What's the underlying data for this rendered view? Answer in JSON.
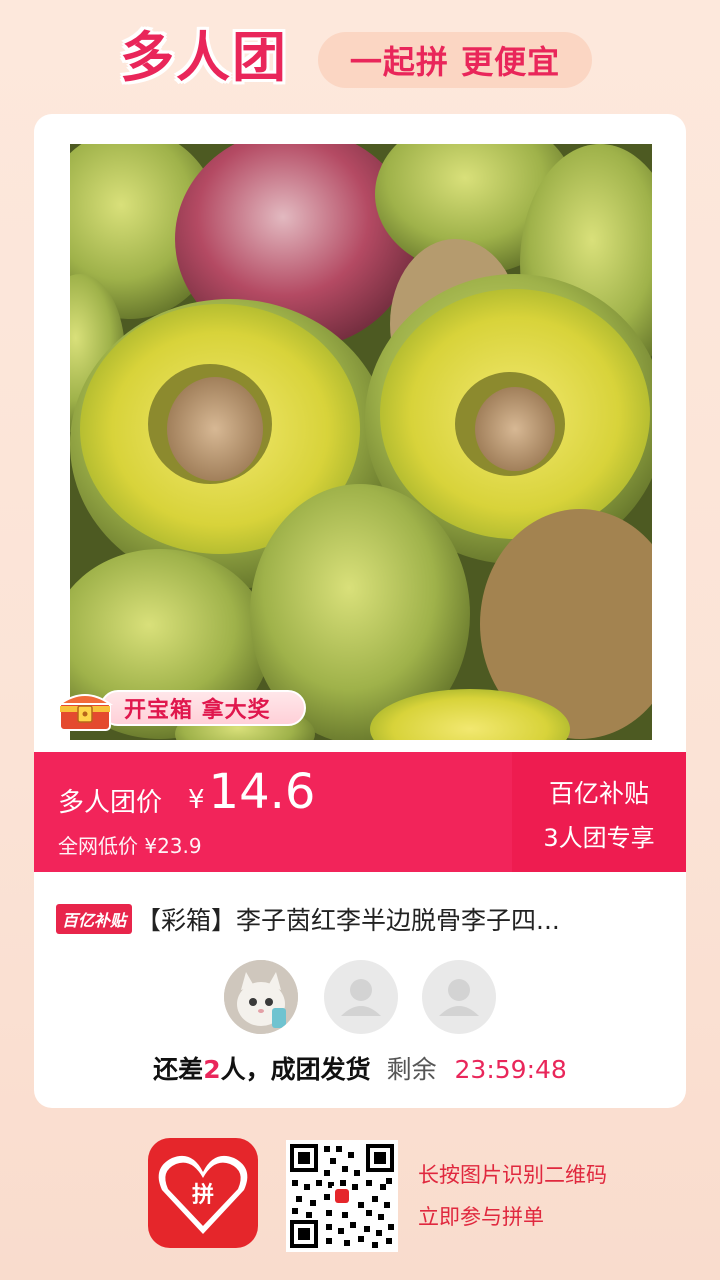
{
  "header": {
    "title": "多人团",
    "slogan": "一起拼 更便宜"
  },
  "badge": {
    "treasure_label": "开宝箱 拿大奖"
  },
  "price": {
    "label": "多人团价",
    "currency": "¥",
    "value": "14.6",
    "original_label": "全网低价",
    "original_value": "¥23.9",
    "subsidy_line1": "百亿补贴",
    "subsidy_line2": "3人团专享"
  },
  "product": {
    "tag": "百亿补贴",
    "title": "【彩箱】李子茵红李半边脱骨李子四..."
  },
  "group": {
    "prefix": "还差",
    "missing": "2",
    "suffix": "人，成团发货",
    "remaining_label": "剩余",
    "timer": "23:59:48"
  },
  "footer": {
    "line1": "长按图片识别二维码",
    "line2": "立即参与拼单"
  },
  "colors": {
    "accent": "#f2245a",
    "brand": "#e9265a"
  }
}
